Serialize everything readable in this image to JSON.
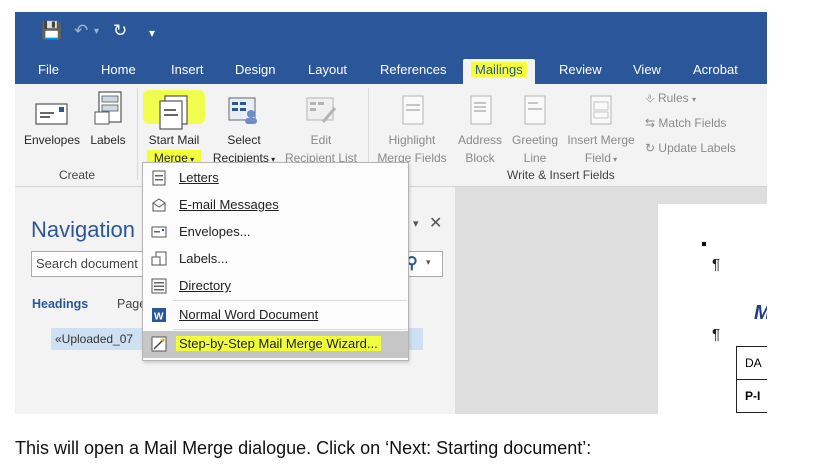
{
  "tabs": [
    "File",
    "Home",
    "Insert",
    "Design",
    "Layout",
    "References",
    "Mailings",
    "Review",
    "View",
    "Acrobat"
  ],
  "ribbon": {
    "create": {
      "envelopes": "Envelopes",
      "labels": "Labels",
      "group": "Create"
    },
    "start_mail_merge": {
      "line1": "Start Mail",
      "line2": "Merge"
    },
    "select_recipients": {
      "line1": "Select",
      "line2": "Recipients"
    },
    "edit_recipient_list": {
      "line1": "Edit",
      "line2": "Recipient List"
    },
    "highlight_merge_fields": {
      "line1": "Highlight",
      "line2": "Merge Fields"
    },
    "address_block": {
      "line1": "Address",
      "line2": "Block"
    },
    "greeting_line": {
      "line1": "Greeting",
      "line2": "Line"
    },
    "insert_merge_field": {
      "line1": "Insert Merge",
      "line2": "Field"
    },
    "rules": "Rules",
    "match_fields": "Match Fields",
    "update_labels": "Update Labels",
    "write_insert_group": "Write & Insert Fields"
  },
  "menu": {
    "items": [
      "Letters",
      "E-mail Messages",
      "Envelopes...",
      "Labels...",
      "Directory",
      "Normal Word Document",
      "Step-by-Step Mail Merge Wizard..."
    ],
    "highlighted_index": 6
  },
  "nav": {
    "title": "Navigation",
    "search_placeholder": "Search document",
    "tab_headings": "Headings",
    "tab_pages": "Page",
    "item": "«Uploaded_07"
  },
  "document": {
    "pilcrow": "¶",
    "heading_fragment": "M",
    "table_cells": [
      "DA",
      "P-I"
    ]
  },
  "caption": "This will open a Mail Merge dialogue. Click on ‘Next: Starting document’:",
  "colors": {
    "ribbon_blue": "#2b579a",
    "highlight_yellow": "#f2ff3b",
    "menu_selected": "#c6c6c6"
  }
}
